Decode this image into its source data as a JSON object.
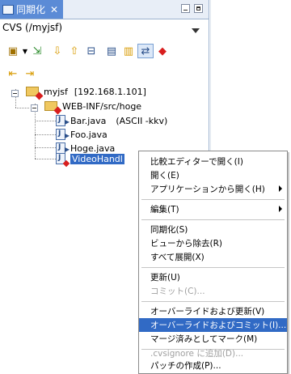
{
  "tab": {
    "title": "同期化",
    "close": "✕"
  },
  "scope": {
    "title": "CVS (/myjsf)"
  },
  "tree": {
    "project": {
      "name": "myjsf",
      "host": "[192.168.1.101]"
    },
    "folder": "WEB-INF/src/hoge",
    "files": [
      {
        "name": "Bar.java",
        "extra": "(ASCII -kkv)"
      },
      {
        "name": "Foo.java",
        "extra": ""
      },
      {
        "name": "Hoge.java",
        "extra": ""
      },
      {
        "name": "VideoHandl",
        "extra": ""
      }
    ]
  },
  "context_menu": {
    "items": [
      {
        "label": "比較エディターで開く(I)",
        "enabled": true,
        "submenu": false
      },
      {
        "label": "開く(E)",
        "enabled": true,
        "submenu": false
      },
      {
        "label": "アプリケーションから開く(H)",
        "enabled": true,
        "submenu": true
      },
      {
        "label": "編集(T)",
        "enabled": true,
        "submenu": true
      },
      {
        "label": "同期化(S)",
        "enabled": true,
        "submenu": false
      },
      {
        "label": "ビューから除去(R)",
        "enabled": true,
        "submenu": false
      },
      {
        "label": "すべて展開(X)",
        "enabled": true,
        "submenu": false
      },
      {
        "label": "更新(U)",
        "enabled": true,
        "submenu": false
      },
      {
        "label": "コミット(C)...",
        "enabled": false,
        "submenu": false
      },
      {
        "label": "オーバーライドおよび更新(V)",
        "enabled": true,
        "submenu": false
      },
      {
        "label": "オーバーライドおよびコミット(I)...",
        "enabled": true,
        "submenu": false,
        "highlighted": true
      },
      {
        "label": "マージ済みとしてマーク(M)",
        "enabled": true,
        "submenu": false
      },
      {
        "label": ".cvsignore に追加(D)...",
        "enabled": false,
        "submenu": false
      },
      {
        "label": "パッチの作成(P)...",
        "enabled": true,
        "submenu": false
      }
    ]
  }
}
